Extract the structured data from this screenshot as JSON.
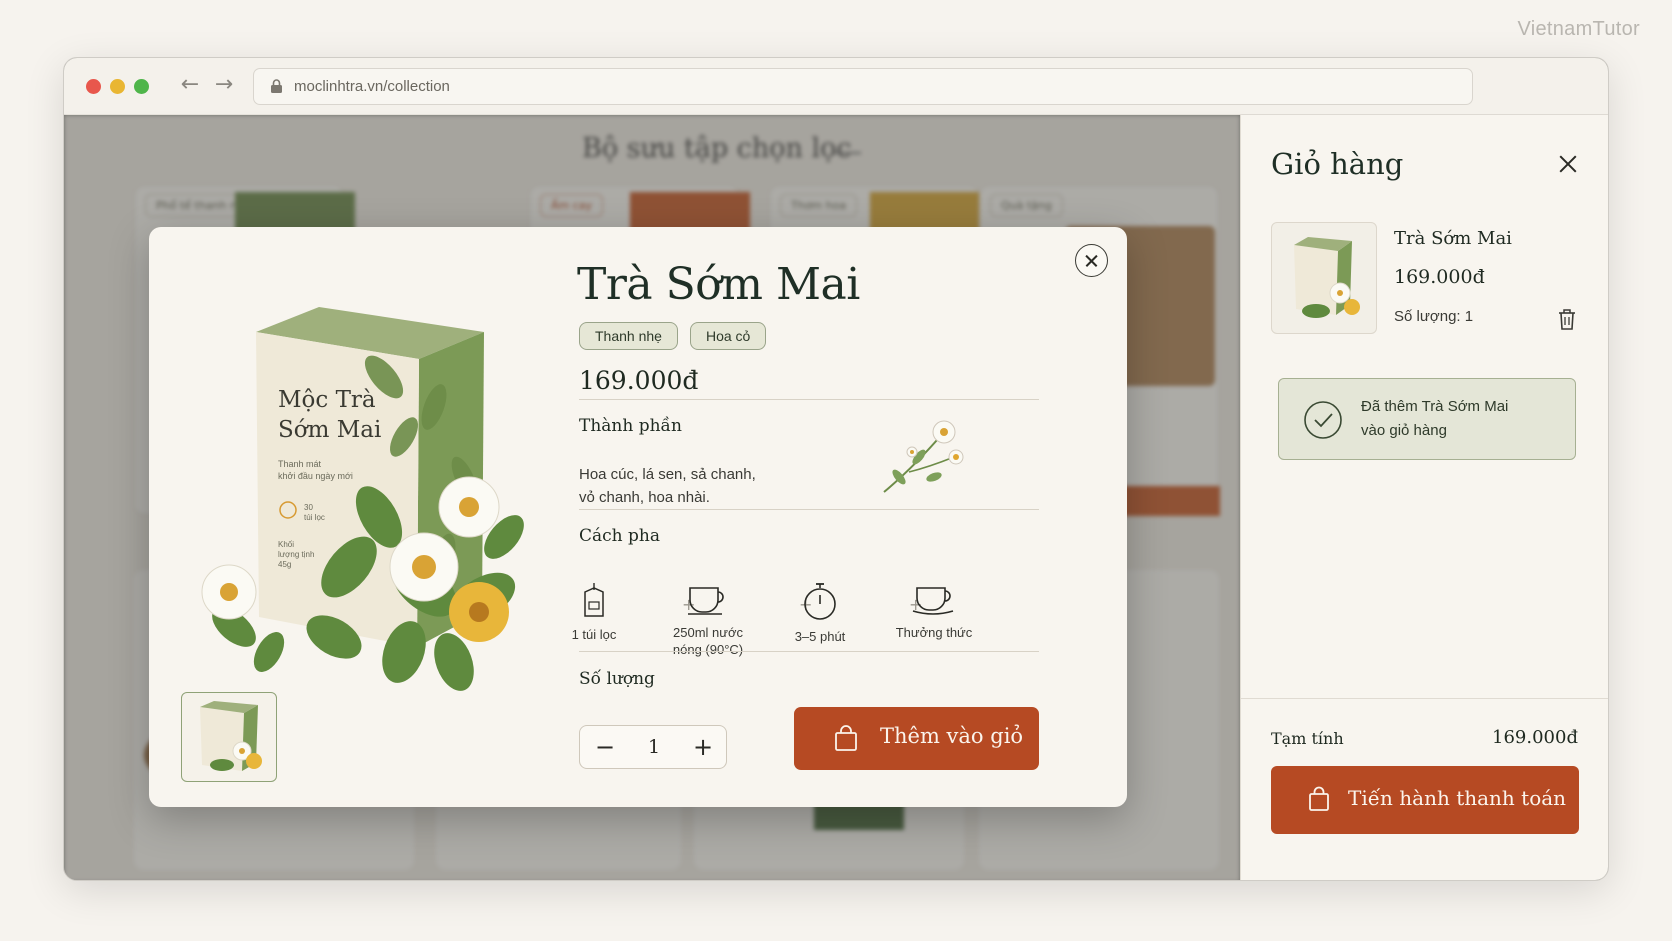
{
  "watermark": "VietnamTutor",
  "browser": {
    "url": "moclinhtra.vn/collection"
  },
  "background_page": {
    "section_title": "Bộ sưu tập chọn lọc",
    "card_tags": [
      "Phổ tể thanh nhẹ",
      "Ấm cay",
      "Thơm hoa",
      "Quà tặng"
    ]
  },
  "modal": {
    "title": "Trà Sớm Mai",
    "tags": [
      "Thanh nhẹ",
      "Hoa cỏ"
    ],
    "price": "169.000đ",
    "ingredients_heading": "Thành phần",
    "ingredients_line1": "Hoa cúc, lá sen, sả chanh,",
    "ingredients_line2": "vỏ chanh, hoa nhài.",
    "brew_heading": "Cách pha",
    "steps": [
      {
        "line1": "1 túi lọc",
        "line2": "",
        "icon": "tea-bag-icon"
      },
      {
        "line1": "250ml nước",
        "line2": "nóng (90°C)",
        "icon": "cup-icon"
      },
      {
        "line1": "3–5 phút",
        "line2": "",
        "icon": "timer-icon"
      },
      {
        "line1": "Thưởng thức",
        "line2": "",
        "icon": "cup-saucer-icon"
      }
    ],
    "quantity_heading": "Số lượng",
    "quantity": "1",
    "minus": "−",
    "plus": "+",
    "add_to_cart": "Thêm vào giỏ",
    "package": {
      "brand_line1": "Mộc Trà",
      "brand_line2": "Sớm Mai",
      "desc_line1": "Thanh mát",
      "desc_line2": "khởi đầu ngày mới",
      "count_line1": "30",
      "count_line2": "túi lọc",
      "weight_line1": "Khối",
      "weight_line2": "lượng tịnh",
      "weight_line3": "45g"
    }
  },
  "cart": {
    "title": "Giỏ hàng",
    "item_name": "Trà Sớm Mai",
    "item_price": "169.000đ",
    "item_qty": "Số lượng: 1",
    "toast_line1": "Đã thêm Trà Sớm Mai",
    "toast_line2": "vào giỏ hàng",
    "subtotal_label": "Tạm tính",
    "subtotal_value": "169.000đ",
    "checkout": "Tiến hành thanh toán"
  },
  "colors": {
    "accent": "#b64a23",
    "sage": "#7e9a5c",
    "toast_bg": "#e4e6d7"
  }
}
